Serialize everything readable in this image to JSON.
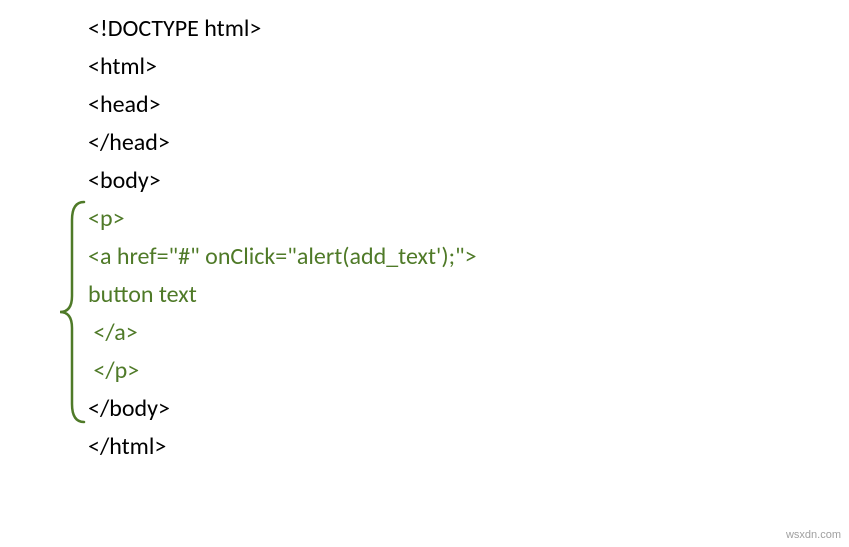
{
  "code": {
    "l1": "<!DOCTYPE html>",
    "l2": "<html>",
    "l3": "<head>",
    "l4": "</head>",
    "l5": "<body>",
    "l6": "<p>",
    "l7": "<a href=\"#\" onClick=\"alert(add_text');\">",
    "l8": "button text",
    "l9": " </a>",
    "l10": " </p>",
    "l11": "</body>",
    "l12": "</html>"
  },
  "watermark": "wsxdn.com"
}
